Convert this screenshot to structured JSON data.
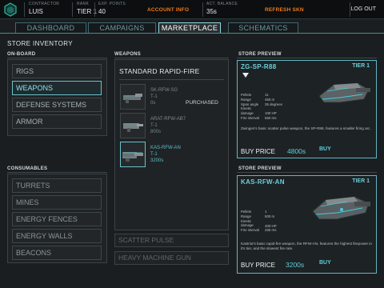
{
  "topbar": {
    "contractor_label": "CONTRACTOR",
    "contractor_value": "LUIS",
    "rank_label": "RANK",
    "rank_value": "TIER 1",
    "exp_label": "EXP. POINTS",
    "exp_value": "40",
    "account_info": "ACCOUNT INFO",
    "balance_label": "ACT. BALANCE",
    "balance_value": "35s",
    "refresh": "REFRESH SKN",
    "logout": "LOG OUT"
  },
  "tabs": [
    "DASHBOARD",
    "CAMPAIGNS",
    "MARKETPLACE",
    "SCHEMATICS"
  ],
  "active_tab": "MARKETPLACE",
  "page_title": "STORE INVENTORY",
  "onboard": {
    "title": "ON-BOARD",
    "items": [
      "RIGS",
      "WEAPONS",
      "DEFENSE SYSTEMS",
      "ARMOR"
    ],
    "selected": "WEAPONS"
  },
  "consumables": {
    "title": "CONSUMABLES",
    "items": [
      "TURRETS",
      "MINES",
      "ENERGY FENCES",
      "ENERGY WALLS",
      "BEACONS"
    ]
  },
  "weapons": {
    "title": "WEAPONS",
    "category": "STANDARD RAPID-FIRE",
    "items": [
      {
        "code": "SK-RFW-SG",
        "tier": "T-1",
        "price": "0s",
        "status": "PURCHASED"
      },
      {
        "code": "ARAT-RFW-AB7",
        "tier": "T-1",
        "price": "800s",
        "status": ""
      },
      {
        "code": "KAS-RFW-AN",
        "tier": "T-1",
        "price": "3200s",
        "status": ""
      }
    ],
    "other_categories": [
      "SCATTER PULSE",
      "HEAVY MACHINE GUN"
    ]
  },
  "previews": [
    {
      "section_title": "STORE PREVIEW",
      "name": "ZG-SP-R88",
      "tier": "TIER 1",
      "stats": [
        [
          "Pellets",
          "11"
        ],
        [
          "Range",
          "450 m"
        ],
        [
          "Span angle",
          "35 degrees"
        ],
        [
          "Kinetic damage",
          "100 HP"
        ],
        [
          "Fire interval",
          "550 ms"
        ]
      ],
      "description": "Zwingen's basic scatter pulse weapon, the SP-R88, features a smaller firing arc.",
      "buy_price_label": "BUY PRICE",
      "price": "4800s",
      "buy_label": "BUY"
    },
    {
      "section_title": "STORE PREVIEW",
      "name": "KAS-RFW-AN",
      "tier": "TIER 1",
      "stats": [
        [
          "Pellets",
          "1"
        ],
        [
          "Range",
          "500 m"
        ],
        [
          "Kinetic damage",
          "400 HP"
        ],
        [
          "Fire interval",
          "265 ms"
        ]
      ],
      "description": "Kastriot's basic rapid-fire weapon, the RFW-AN, features the highest firepower in it's tier, and the slowest fire rate.",
      "buy_price_label": "BUY PRICE",
      "price": "3200s",
      "buy_label": "BUY"
    }
  ],
  "colors": {
    "accent": "#5fcfdc",
    "warning": "#f07a1a",
    "background": "#1b1e20"
  }
}
